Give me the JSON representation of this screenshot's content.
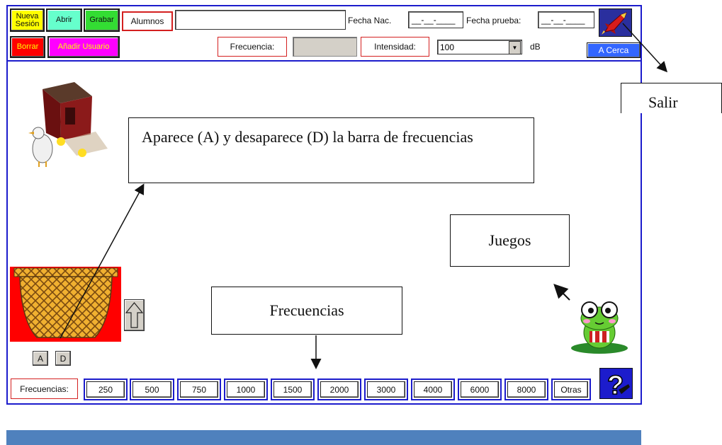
{
  "toolbar": {
    "nueva_sesion": "Nueva Sesión",
    "abrir": "Abrir",
    "grabar": "Grabar",
    "borrar": "Borrar",
    "anadir_usuario": "Añadir Usuario",
    "alumnos_label": "Alumnos",
    "alumnos_value": "",
    "fecha_nac_label": "Fecha Nac.",
    "fecha_nac_value": "__-__-____",
    "fecha_prueba_label": "Fecha prueba:",
    "fecha_prueba_value": "__-__-____",
    "frecuencia_label": "Frecuencia:",
    "frecuencia_value": "",
    "intensidad_label": "Intensidad:",
    "intensidad_value": "100",
    "db_label": "dB",
    "acerca": "A Cerca"
  },
  "icons": {
    "exit": "rocket-exit-icon",
    "help": "help-question-icon",
    "arrow_up": "arrow-up-icon",
    "dropdown": "chevron-down-icon"
  },
  "toggle": {
    "a": "A",
    "d": "D"
  },
  "frequencies": {
    "label": "Frecuencias:",
    "items": [
      "250",
      "500",
      "750",
      "1000",
      "1500",
      "2000",
      "3000",
      "4000",
      "6000",
      "8000",
      "Otras"
    ]
  },
  "annotations": {
    "salir": "Salir",
    "barra": "Aparece (A) y desaparece (D) la barra de frecuencias",
    "juegos": "Juegos",
    "frecuencias": "Frecuencias"
  },
  "colors": {
    "frame": "#1c1ccc",
    "nueva_sesion": "#ffff00",
    "abrir": "#66ffcc",
    "grabar": "#33dd33",
    "borrar": "#ff0000",
    "anadir_usuario": "#ff00ff",
    "acerca": "#3366ff",
    "bottom_bar": "#4f81bd"
  }
}
